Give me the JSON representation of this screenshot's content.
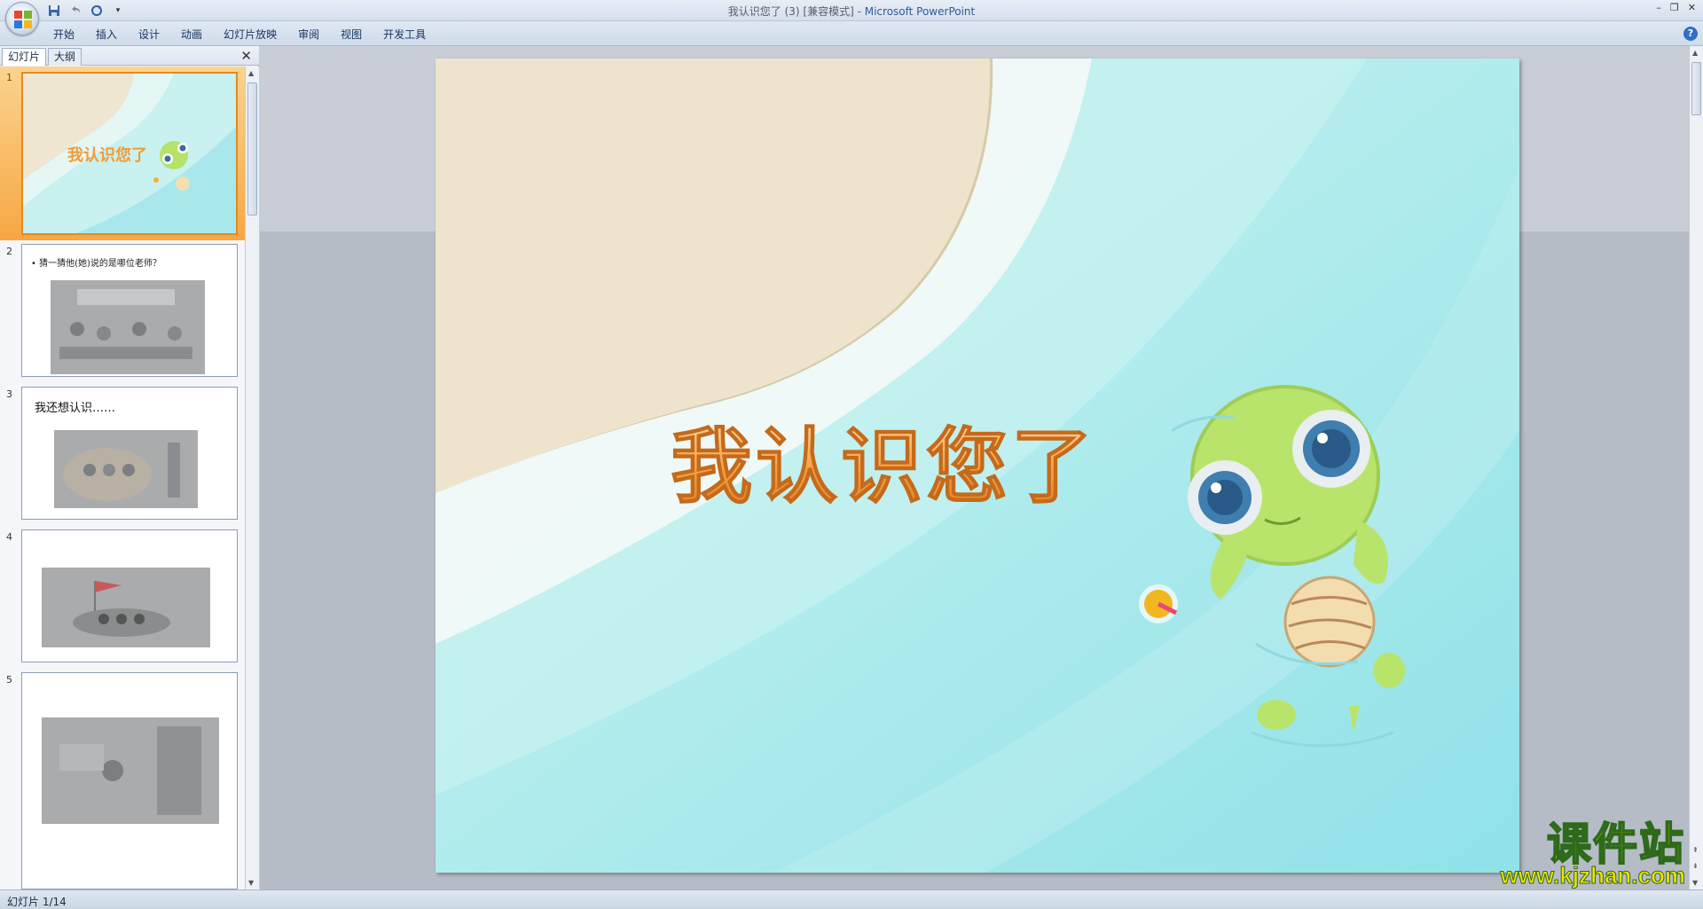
{
  "window": {
    "title_doc": "我认识您了 (3) [兼容模式]",
    "title_sep": " - ",
    "title_app": "Microsoft PowerPoint"
  },
  "ribbon": {
    "tabs": [
      "开始",
      "插入",
      "设计",
      "动画",
      "幻灯片放映",
      "审阅",
      "视图",
      "开发工具"
    ]
  },
  "left_pane": {
    "tab_slides": "幻灯片",
    "tab_outline": "大纲",
    "thumbnails": [
      {
        "num": "1",
        "text": "我认识您了"
      },
      {
        "num": "2",
        "text": "• 猜一猜他(她)说的是哪位老师？"
      },
      {
        "num": "3",
        "text": "我还想认识……"
      },
      {
        "num": "4",
        "text": ""
      },
      {
        "num": "5",
        "text": ""
      }
    ]
  },
  "slide": {
    "title": "我认识您了"
  },
  "status": {
    "slide_counter": "幻灯片 1/14"
  },
  "watermark": {
    "cn": "课件站",
    "url": "www.kjzhan.com"
  },
  "colors": {
    "accent_orange": "#f4a43c",
    "selected_thumb": "#f7a743",
    "sea": "#a8e8ec",
    "sand": "#efe3c8"
  }
}
